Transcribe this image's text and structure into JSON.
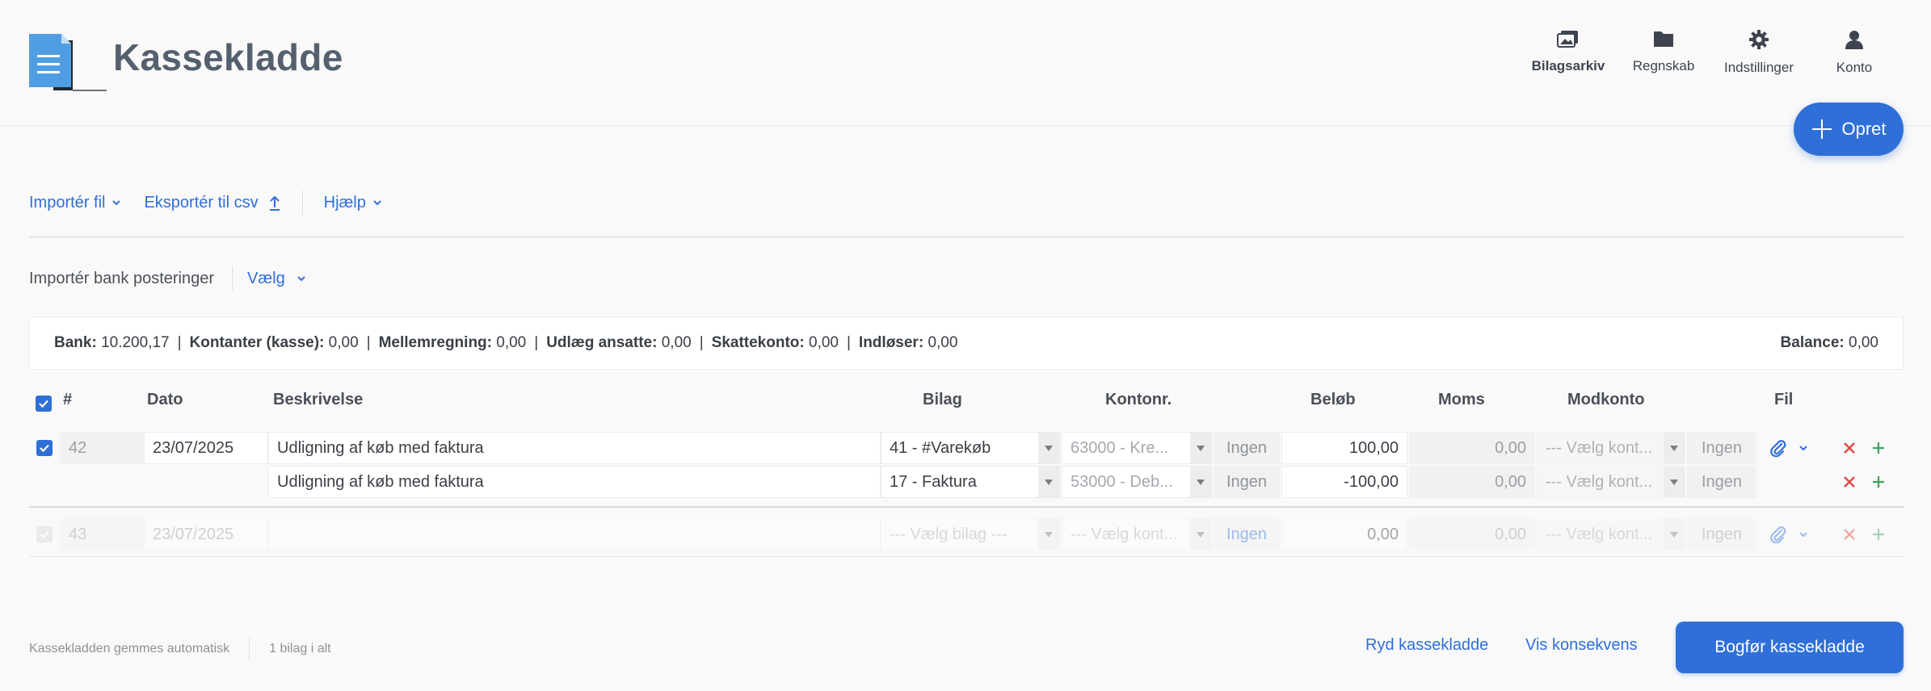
{
  "app": {
    "title": "Kassekladde"
  },
  "topnav": [
    {
      "label": "Bilagsarkiv",
      "icon": "photo-archive-icon"
    },
    {
      "label": "Regnskab",
      "icon": "folder-icon"
    },
    {
      "label": "Indstillinger",
      "icon": "gear-icon"
    },
    {
      "label": "Konto",
      "icon": "user-icon"
    }
  ],
  "fab": {
    "label": "Opret"
  },
  "toolbar": {
    "import_file": "Importér fil",
    "export_csv": "Eksportér til csv",
    "help": "Hjælp"
  },
  "import_bank": {
    "label": "Importér bank posteringer",
    "select": "Vælg"
  },
  "balances": {
    "bank_label": "Bank:",
    "bank_value": "10.200,17",
    "cash_label": "Kontanter (kasse):",
    "cash_value": "0,00",
    "intermediate_label": "Mellemregning:",
    "intermediate_value": "0,00",
    "employee_label": "Udlæg ansatte:",
    "employee_value": "0,00",
    "tax_label": "Skattekonto:",
    "tax_value": "0,00",
    "redeemer_label": "Indløser:",
    "redeemer_value": "0,00",
    "separator": "|",
    "balance_label": "Balance:",
    "balance_value": "0,00"
  },
  "table": {
    "headers": {
      "num": "#",
      "date": "Dato",
      "description": "Beskrivelse",
      "voucher": "Bilag",
      "account": "Kontonr.",
      "amount": "Beløb",
      "vat": "Moms",
      "counter": "Modkonto",
      "file": "Fil"
    },
    "entries": [
      {
        "number": "42",
        "date": "23/07/2025",
        "checked": true,
        "lines": [
          {
            "description": "Udligning af køb med faktura",
            "voucher": "41 - #Varekøb",
            "account": "63000 - Kre...",
            "vat_code": "Ingen",
            "amount": "100,00",
            "vat": "0,00",
            "counter": "--- Vælg kont...",
            "counter_vat": "Ingen"
          },
          {
            "description": "Udligning af køb med faktura",
            "voucher": "17 - Faktura",
            "account": "53000 - Deb...",
            "vat_code": "Ingen",
            "amount": "-100,00",
            "vat": "0,00",
            "counter": "--- Vælg kont...",
            "counter_vat": "Ingen"
          }
        ]
      }
    ],
    "new_row": {
      "number": "43",
      "date": "23/07/2025",
      "description": "",
      "voucher_placeholder": "--- Vælg bilag ---",
      "account_placeholder": "--- Vælg kont...",
      "vat_code": "Ingen",
      "amount": "0,00",
      "vat": "0,00",
      "counter_placeholder": "--- Vælg kont...",
      "counter_vat": "Ingen"
    }
  },
  "footer": {
    "autosave": "Kassekladden gemmes automatisk",
    "count": "1 bilag i alt",
    "clear": "Ryd kassekladde",
    "consequences": "Vis konsekvens",
    "post": "Bogfør kassekladde"
  },
  "colors": {
    "accent": "#2f6fd8",
    "delete": "#e04848",
    "add": "#3aa55a"
  }
}
